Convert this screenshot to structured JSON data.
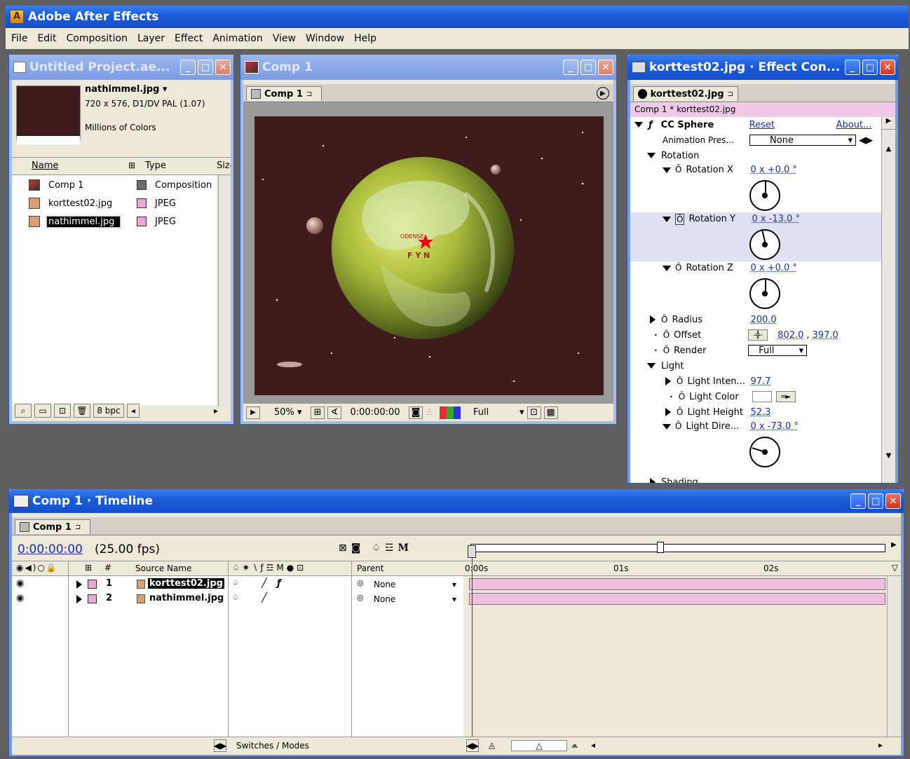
{
  "app": {
    "title": "Adobe After Effects"
  },
  "menu": [
    "File",
    "Edit",
    "Composition",
    "Layer",
    "Effect",
    "Animation",
    "View",
    "Window",
    "Help"
  ],
  "project": {
    "title": "Untitled Project.ae...",
    "preview_name": "nathimmel.jpg",
    "preview_dims": "720 x 576, D1/DV PAL (1.07)",
    "preview_colors": "Millions of Colors",
    "columns": {
      "name": "Name",
      "type": "Type",
      "size": "Size"
    },
    "items": [
      {
        "name": "Comp 1",
        "type": "Composition",
        "swatch": "#6a6a6a"
      },
      {
        "name": "korttest02.jpg",
        "type": "JPEG",
        "swatch": "#e9a6d8"
      },
      {
        "name": "nathimmel.jpg",
        "type": "JPEG",
        "swatch": "#e9a6d8"
      }
    ],
    "bpc": "8 bpc"
  },
  "comp": {
    "title": "Comp 1",
    "tab": "Comp 1",
    "zoom": "50%",
    "timecode": "0:00:00:00",
    "resolution": "Full",
    "globe_label": "ODENSE",
    "globe_label2": "F Y N",
    "bg_color": "#3f1c1c"
  },
  "effects": {
    "title": "korttest02.jpg · Effect Con...",
    "tab": "korttest02.jpg",
    "breadcrumb": "Comp 1 * korttest02.jpg",
    "effect_name": "CC Sphere",
    "reset": "Reset",
    "about": "About...",
    "anim_preset_label": "Animation Pres...",
    "anim_preset_value": "None",
    "rotation_label": "Rotation",
    "rot_x_label": "Rotation X",
    "rot_x_value": "0 x +0.0 °",
    "rot_y_label": "Rotation Y",
    "rot_y_value": "0 x -13.0 °",
    "rot_z_label": "Rotation Z",
    "rot_z_value": "0 x +0.0 °",
    "radius_label": "Radius",
    "radius_value": "200.0",
    "offset_label": "Offset",
    "offset_x": "802.0",
    "offset_y": "397.0",
    "render_label": "Render",
    "render_value": "Full",
    "light_label": "Light",
    "light_intensity_label": "Light Inten...",
    "light_intensity_value": "97.7",
    "light_color_label": "Light Color",
    "light_height_label": "Light Height",
    "light_height_value": "52.3",
    "light_dir_label": "Light Dire...",
    "light_dir_value": "0 x -73.0 °",
    "shading_label": "Shading",
    "rotation_y_deg": -13,
    "light_dir_deg": -73
  },
  "timeline": {
    "title": "Comp 1 · Timeline",
    "tab": "Comp 1",
    "timecode": "0:00:00:00",
    "fps": "(25.00 fps)",
    "col_source": "Source Name",
    "col_parent": "Parent",
    "hash": "#",
    "ruler": [
      "0:00s",
      "01s",
      "02s"
    ],
    "layers": [
      {
        "num": "1",
        "name": "korttest02.jpg",
        "parent": "None",
        "selected": true
      },
      {
        "num": "2",
        "name": "nathimmel.jpg",
        "parent": "None",
        "selected": false
      }
    ],
    "switches_modes": "Switches / Modes",
    "bar_color": "#f0bfe0"
  }
}
